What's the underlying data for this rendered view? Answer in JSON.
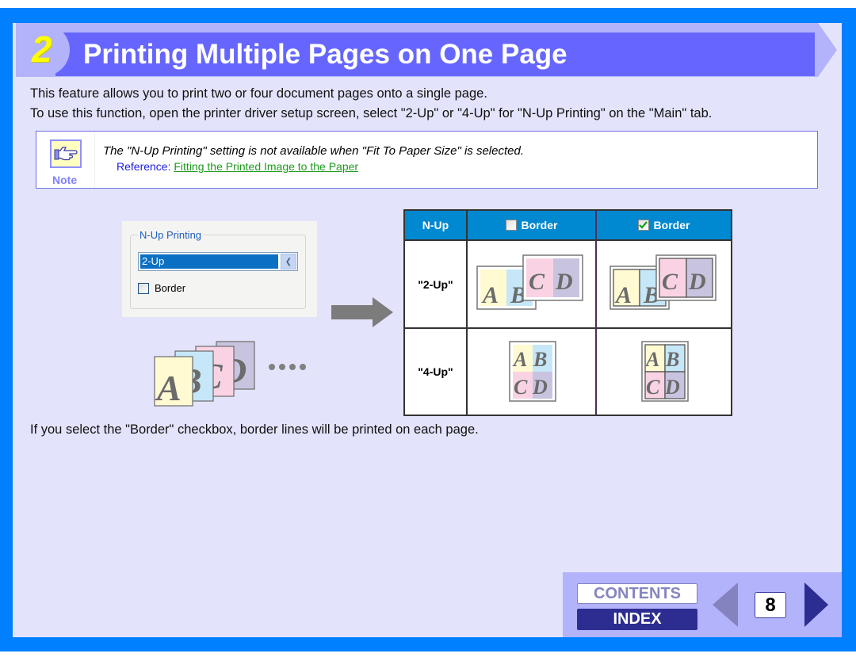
{
  "header": {
    "section_number": "2",
    "title": "Printing Multiple Pages on One Page"
  },
  "intro": {
    "line1": "This feature allows you to print two or four document pages onto a single page.",
    "line2": "To use this function, open the printer driver setup screen, select \"2-Up\" or \"4-Up\" for \"N-Up Printing\" on the \"Main\" tab."
  },
  "note": {
    "icon": "pointing-hand-icon",
    "label": "Note",
    "text": "The \"N-Up Printing\" setting is not available when \"Fit To Paper Size\" is selected.",
    "reference_prefix": "Reference: ",
    "reference_link": "Fitting the Printed Image to the Paper"
  },
  "dialog": {
    "group_label": "N-Up Printing",
    "select_value": "2-Up",
    "border_label": "Border",
    "border_checked": false
  },
  "illustration": {
    "pages": [
      "A",
      "B",
      "C",
      "D"
    ],
    "continuation": "...."
  },
  "table": {
    "headers": {
      "col1": "N-Up",
      "col2": "Border",
      "col2_checked": false,
      "col3": "Border",
      "col3_checked": true
    },
    "rows": [
      {
        "label": "\"2-Up\""
      },
      {
        "label": "\"4-Up\""
      }
    ],
    "page_letters": [
      "A",
      "B",
      "C",
      "D"
    ]
  },
  "outro": "If you select the \"Border\" checkbox, border lines will be printed on each page.",
  "nav": {
    "contents_label": "CONTENTS",
    "index_label": "INDEX",
    "page_number": "8",
    "prev_icon": "triangle-left-icon",
    "next_icon": "triangle-right-icon"
  },
  "colors": {
    "frame": "#0080ff",
    "page_bg": "#e3e3fb",
    "header_dark": "#6666ff",
    "header_light": "#b3b3fb",
    "section_number": "#ffff00",
    "table_header": "#0088d0",
    "link": "#1f9a1f",
    "index_button": "#2d2d91"
  }
}
